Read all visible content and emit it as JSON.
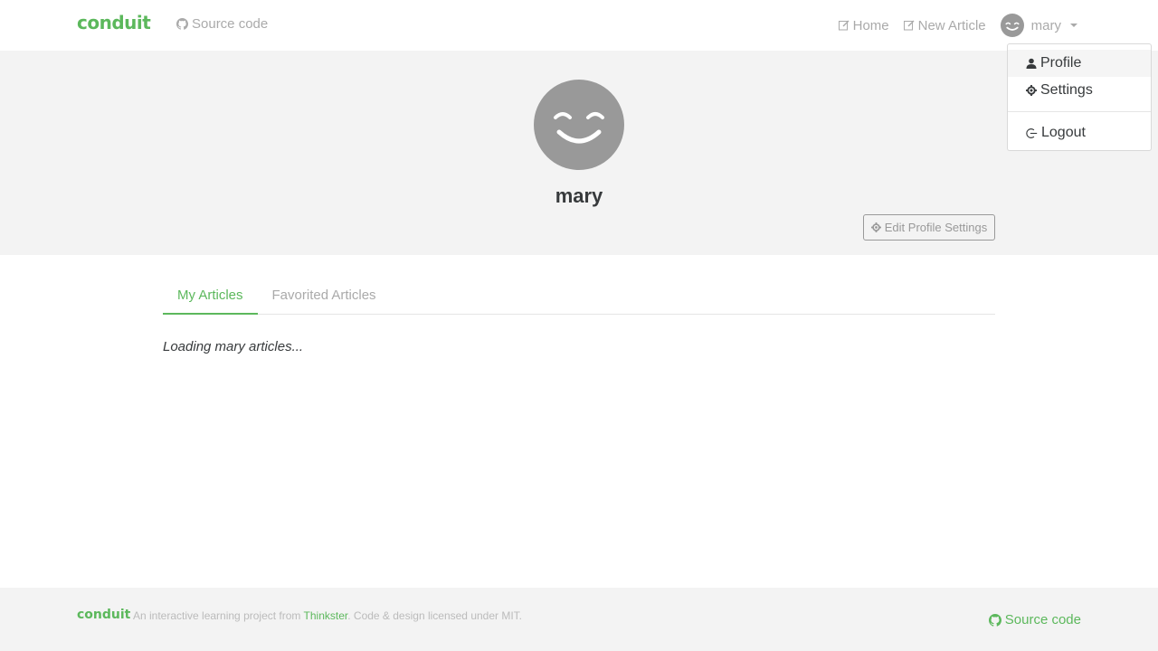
{
  "navbar": {
    "brand": "conduit",
    "source_code": "Source code",
    "home": "Home",
    "new_article": "New Article",
    "username": "mary"
  },
  "dropdown": {
    "profile": "Profile",
    "settings": "Settings",
    "logout": "Logout"
  },
  "profile": {
    "username": "mary",
    "edit_button": "Edit Profile Settings"
  },
  "tabs": {
    "my_articles": "My Articles",
    "favorited_articles": "Favorited Articles"
  },
  "content": {
    "loading": "Loading mary articles..."
  },
  "footer": {
    "brand": "conduit",
    "attribution_prefix": "An interactive learning project from ",
    "attribution_link": "Thinkster",
    "attribution_suffix": ". Code & design licensed under MIT.",
    "source_code": "Source code"
  },
  "colors": {
    "accent": "#5cb85c",
    "banner_bg": "#f3f3f3",
    "avatar_bg": "#999999"
  },
  "icons": [
    "github-icon",
    "edit-icon",
    "user-icon",
    "gear-icon",
    "logout-icon",
    "caret-down-icon",
    "smiley-avatar-icon"
  ]
}
